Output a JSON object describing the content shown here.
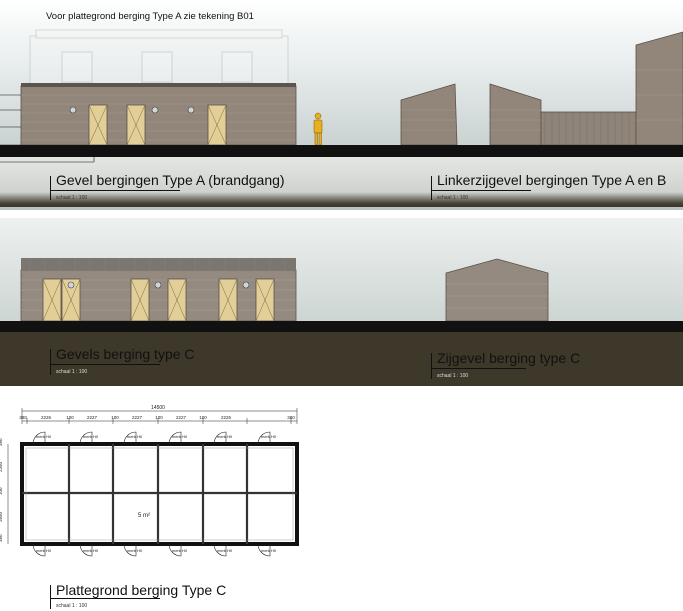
{
  "note": "Voor plattegrond berging Type A zie tekening B01",
  "views": [
    {
      "title": "Gevel bergingen Type A (brandgang)",
      "scale": "schaal 1 : 100"
    },
    {
      "title": "Linkerzijgevel bergingen Type A en B",
      "scale": "schaal 1 : 100"
    },
    {
      "title": "Gevels berging type C",
      "scale": "schaal 1 : 100"
    },
    {
      "title": "Zijgevel berging type C",
      "scale": "schaal 1 : 100"
    },
    {
      "title": "Plattegrond berging Type C",
      "scale": "schaal 1 : 100"
    }
  ],
  "plan": {
    "overall_dimension": "14500",
    "dimensions": [
      "380",
      "2226",
      "100",
      "2227",
      "100",
      "2227",
      "100",
      "2227",
      "100",
      "2226",
      "380"
    ],
    "vertical_dimensions": [
      "380",
      "2350",
      "100",
      "2650",
      "380"
    ],
    "area_label": "5 m²",
    "door_label": "merk H0"
  },
  "colors": {
    "cladding": "#8f8378",
    "door": "#e2cf98",
    "ground": "#111111",
    "earth": "#3d3829"
  }
}
